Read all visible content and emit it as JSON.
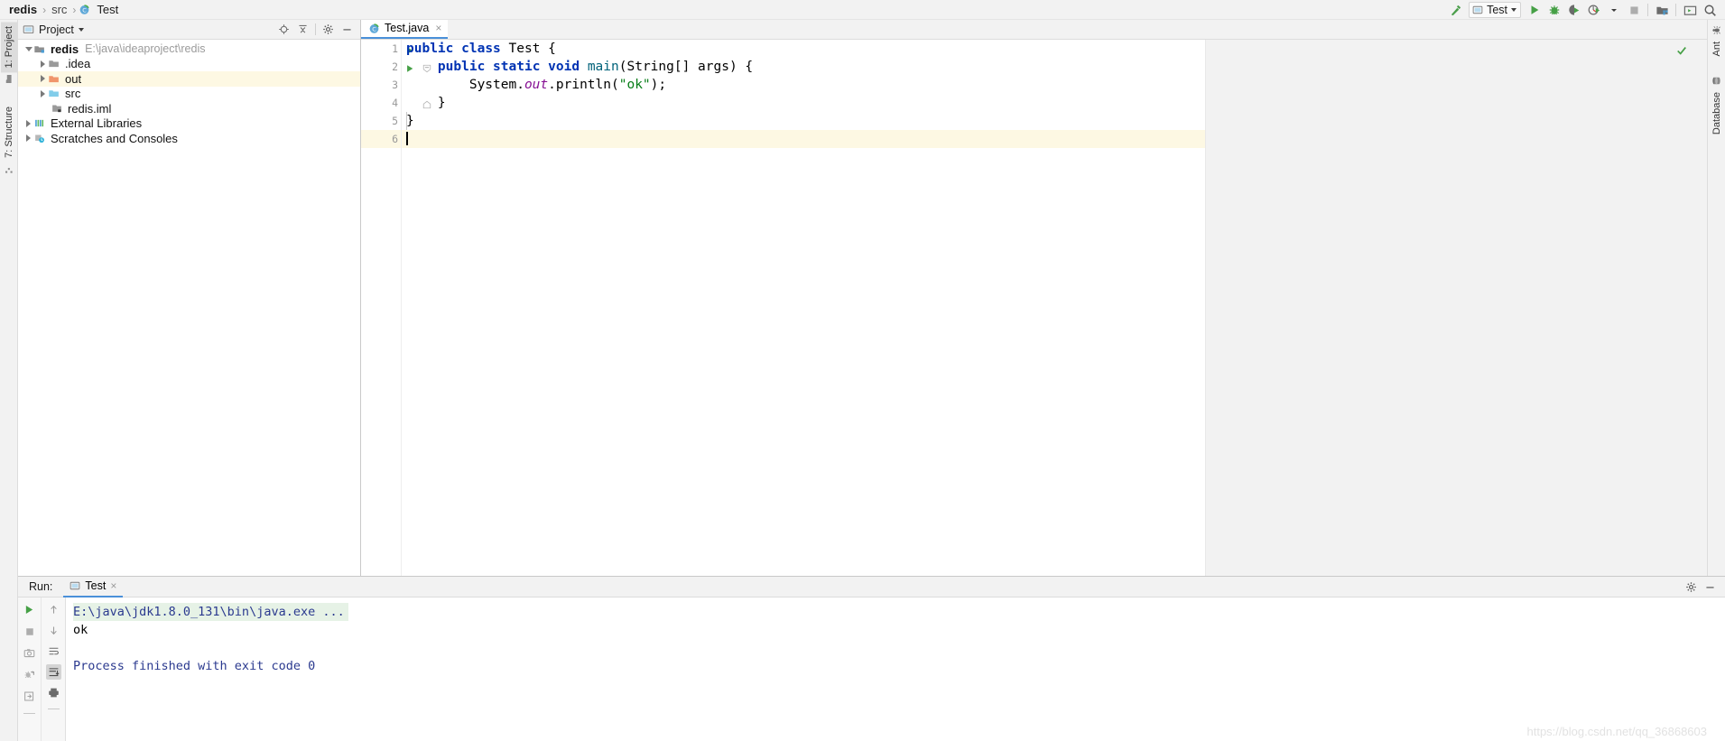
{
  "breadcrumb": {
    "items": [
      {
        "label": "redis",
        "bold": true,
        "icon": null
      },
      {
        "label": "src",
        "bold": false,
        "icon": null
      },
      {
        "label": "Test",
        "bold": false,
        "icon": "java-class-icon"
      }
    ],
    "separator": "›"
  },
  "toolbar": {
    "build_label": "Build",
    "run_config_name": "Test",
    "run_label": "Run",
    "debug_label": "Debug",
    "run_coverage_label": "Run with Coverage",
    "profiler_label": "Profiler",
    "stop_label": "Stop",
    "project_structure_label": "Project Structure",
    "terminal_label": "Terminal",
    "search_label": "Search Everywhere"
  },
  "left_strip": {
    "tabs": [
      {
        "label": "1: Project",
        "active": true,
        "icon": "project-icon"
      },
      {
        "label": "7: Structure",
        "active": false,
        "icon": "structure-icon"
      }
    ]
  },
  "right_strip": {
    "tabs": [
      {
        "label": "Ant",
        "icon": "ant-icon"
      },
      {
        "label": "Database",
        "icon": "database-icon"
      }
    ]
  },
  "project_panel": {
    "title": "Project",
    "header_icons": [
      "locate-icon",
      "collapse-all-icon",
      "settings-gear-icon",
      "minimize-icon"
    ],
    "tree": [
      {
        "label": "redis",
        "path": "E:\\java\\ideaproject\\redis",
        "indent": 0,
        "arrow": "open",
        "icon": "module-icon",
        "bold": true,
        "selected": false
      },
      {
        "label": ".idea",
        "path": "",
        "indent": 1,
        "arrow": "closed",
        "icon": "folder-grey-icon",
        "bold": false,
        "selected": false
      },
      {
        "label": "out",
        "path": "",
        "indent": 1,
        "arrow": "closed",
        "icon": "folder-orange-icon",
        "bold": false,
        "selected": true
      },
      {
        "label": "src",
        "path": "",
        "indent": 1,
        "arrow": "closed",
        "icon": "folder-blue-icon",
        "bold": false,
        "selected": false
      },
      {
        "label": "redis.iml",
        "path": "",
        "indent": 1,
        "arrow": "none",
        "icon": "iml-file-icon",
        "bold": false,
        "selected": false
      },
      {
        "label": "External Libraries",
        "path": "",
        "indent": 0,
        "arrow": "closed",
        "icon": "libraries-icon",
        "bold": false,
        "selected": false
      },
      {
        "label": "Scratches and Consoles",
        "path": "",
        "indent": 0,
        "arrow": "closed",
        "icon": "scratches-icon",
        "bold": false,
        "selected": false
      }
    ]
  },
  "editor": {
    "tab": {
      "label": "Test.java",
      "icon": "java-class-icon",
      "close": "×"
    },
    "inspection_status": "ok-checkmark",
    "lines": [
      {
        "num": "1",
        "gutter_run": true,
        "gutter_fold": false,
        "highlight": false,
        "tokens": [
          {
            "t": "public",
            "c": "kw"
          },
          {
            "t": " ",
            "c": "pun"
          },
          {
            "t": "class",
            "c": "kw"
          },
          {
            "t": " ",
            "c": "pun"
          },
          {
            "t": "Test",
            "c": "cls"
          },
          {
            "t": " {",
            "c": "pun"
          }
        ]
      },
      {
        "num": "2",
        "gutter_run": true,
        "gutter_fold": true,
        "highlight": false,
        "tokens": [
          {
            "t": "    ",
            "c": "pun"
          },
          {
            "t": "public",
            "c": "kw"
          },
          {
            "t": " ",
            "c": "pun"
          },
          {
            "t": "static",
            "c": "kw"
          },
          {
            "t": " ",
            "c": "pun"
          },
          {
            "t": "void",
            "c": "kw"
          },
          {
            "t": " ",
            "c": "pun"
          },
          {
            "t": "main",
            "c": "mth"
          },
          {
            "t": "(String[] args) {",
            "c": "pun"
          }
        ]
      },
      {
        "num": "3",
        "gutter_run": false,
        "gutter_fold": false,
        "highlight": false,
        "tokens": [
          {
            "t": "        System.",
            "c": "pun"
          },
          {
            "t": "out",
            "c": "fld"
          },
          {
            "t": ".println(",
            "c": "pun"
          },
          {
            "t": "\"ok\"",
            "c": "str"
          },
          {
            "t": ");",
            "c": "pun"
          }
        ]
      },
      {
        "num": "4",
        "gutter_run": false,
        "gutter_fold": true,
        "highlight": false,
        "tokens": [
          {
            "t": "    }",
            "c": "pun"
          }
        ]
      },
      {
        "num": "5",
        "gutter_run": false,
        "gutter_fold": false,
        "highlight": false,
        "tokens": [
          {
            "t": "}",
            "c": "pun"
          }
        ]
      },
      {
        "num": "6",
        "gutter_run": false,
        "gutter_fold": false,
        "highlight": true,
        "caret": true,
        "tokens": []
      }
    ]
  },
  "run_panel": {
    "label": "Run:",
    "tab": {
      "label": "Test",
      "icon": "run-config-icon",
      "close": "×"
    },
    "header_icons": [
      "settings-gear-icon",
      "minimize-icon"
    ],
    "side_icons_left": [
      "rerun-icon",
      "stop-icon",
      "camera-icon",
      "thread-dump-icon",
      "export-icon"
    ],
    "side_icons_right": [
      "scroll-up-icon",
      "scroll-down-icon",
      "soft-wrap-icon",
      "scroll-to-end-icon",
      "print-icon"
    ],
    "console": [
      {
        "text": "E:\\java\\jdk1.8.0_131\\bin\\java.exe ...",
        "style": "cmd"
      },
      {
        "text": "ok",
        "style": "out"
      },
      {
        "text": "",
        "style": "out"
      },
      {
        "text": "Process finished with exit code 0",
        "style": "fin"
      }
    ]
  },
  "watermark": {
    "text": "https://blog.csdn.net/qq_36868603"
  },
  "colors": {
    "accent_blue": "#4a90d9",
    "selection_yellow": "#fdf8e3",
    "keyword_blue": "#0033b3",
    "string_green": "#067d17",
    "field_purple": "#871094",
    "method_teal": "#00627a",
    "console_blue": "#2b3a8f",
    "console_cmd_bg": "#e6f2e6",
    "run_green": "#3c9b3c"
  }
}
